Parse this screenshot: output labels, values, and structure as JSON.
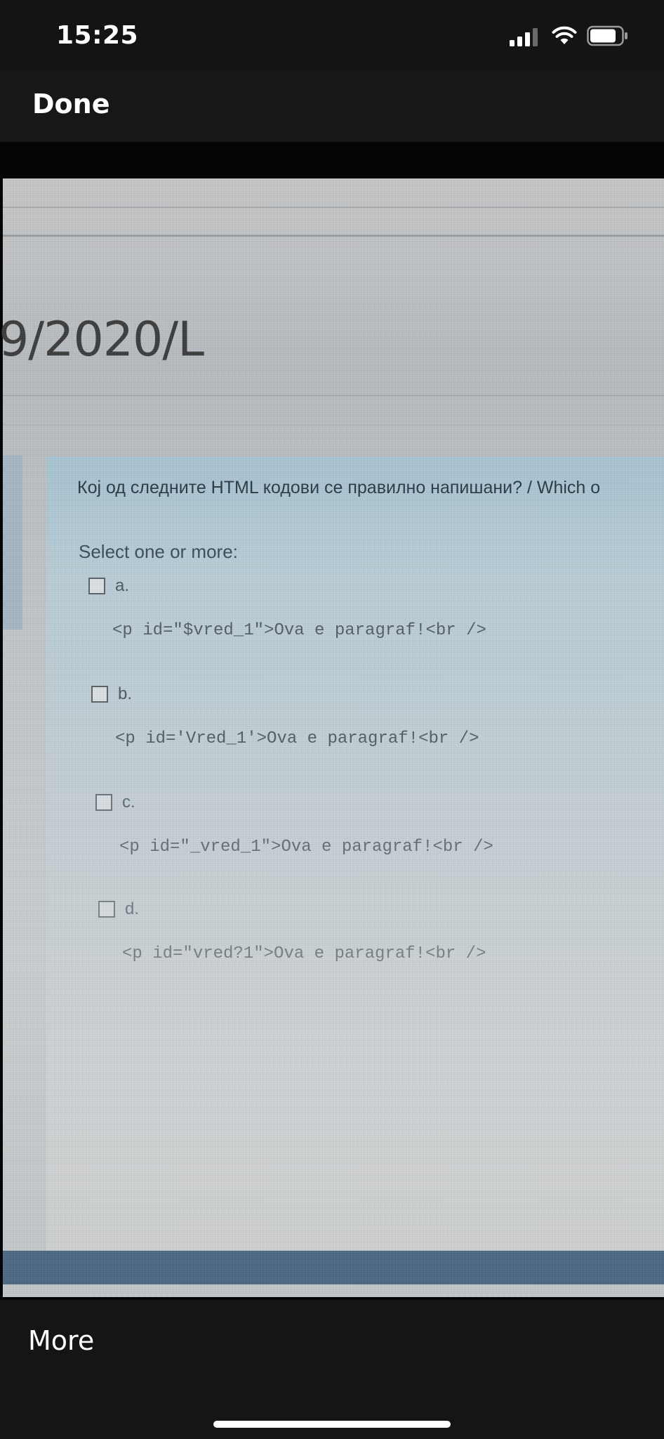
{
  "status_bar": {
    "time": "15:25"
  },
  "nav": {
    "done_label": "Done"
  },
  "photo": {
    "course_title": "9/2020/L",
    "question": "Кој од следните HTML кодови се правилно напишани? / Which o",
    "select_hint": "Select one or more:",
    "options": [
      {
        "letter": "a.",
        "code": "<p id=\"$vred_1\">Ova e paragraf!<br />"
      },
      {
        "letter": "b.",
        "code": "<p id='Vred_1'>Ova e paragraf!<br />"
      },
      {
        "letter": "c.",
        "code": "<p id=\"_vred_1\">Ova e paragraf!<br />"
      },
      {
        "letter": "d.",
        "code": "<p id=\"vred?1\">Ova e paragraf!<br />"
      }
    ]
  },
  "toolbar": {
    "more_label": "More"
  },
  "colors": {
    "panel_accent": "#a9c6d5",
    "footer_bar": "#4d6883"
  }
}
